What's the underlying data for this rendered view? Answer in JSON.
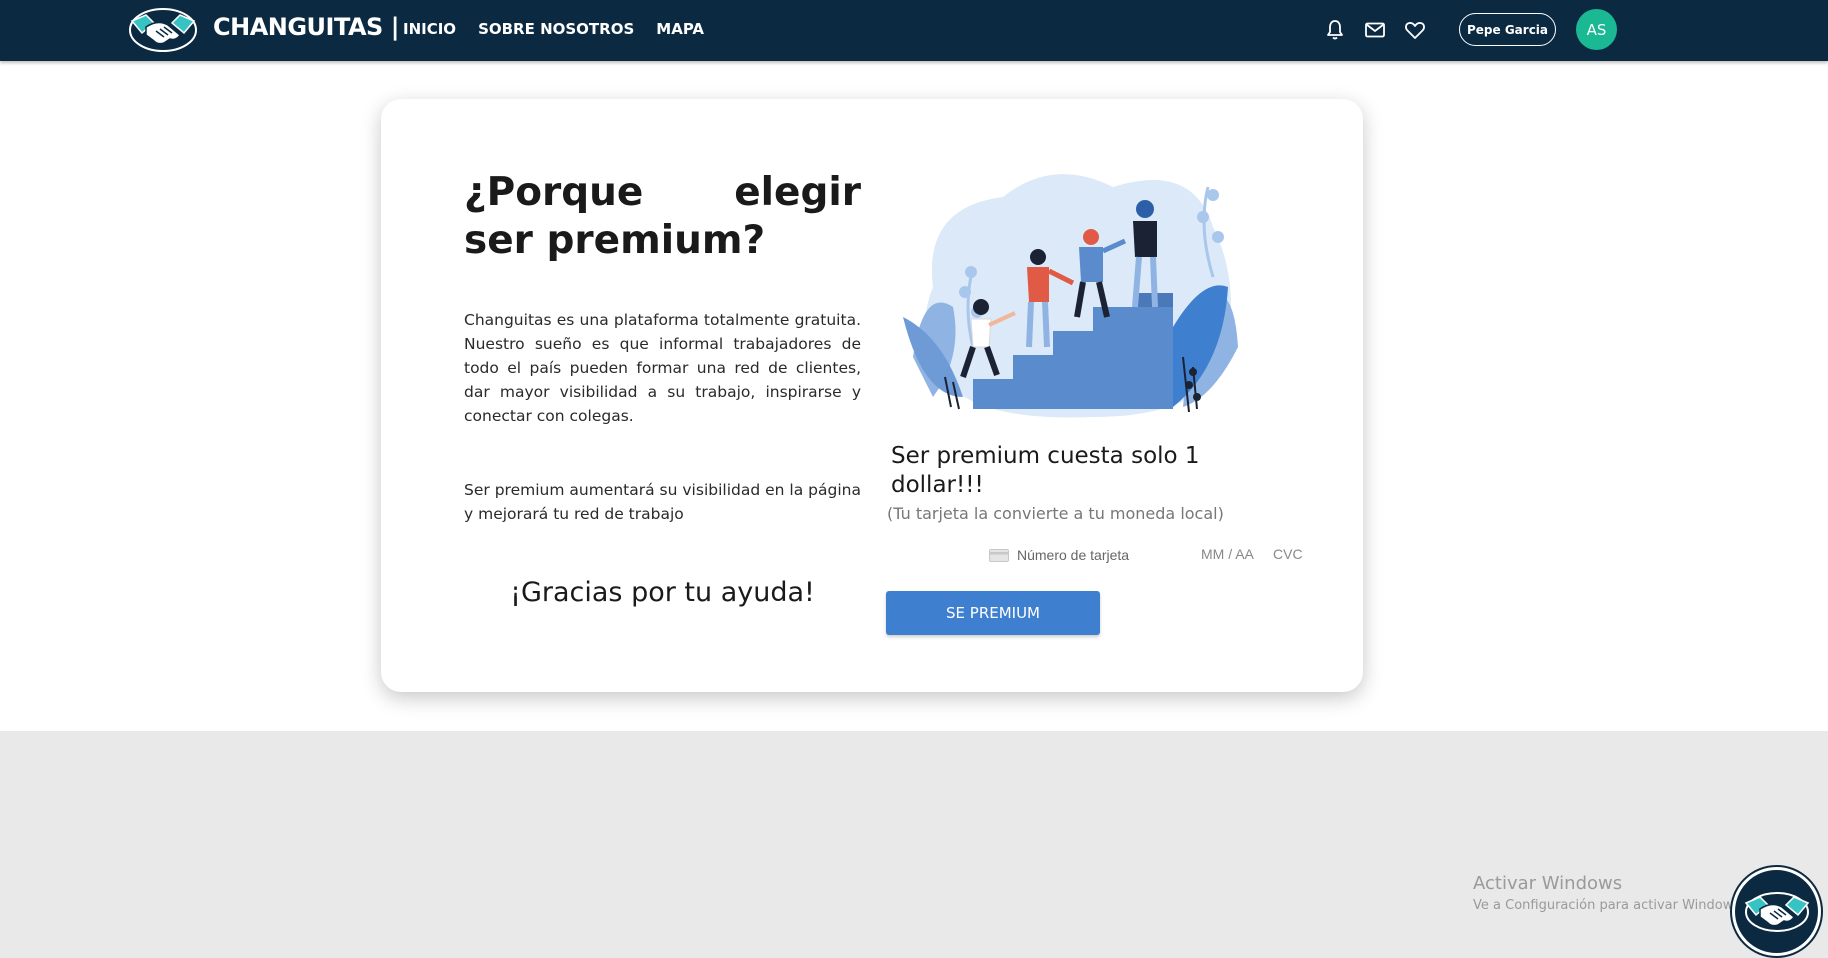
{
  "navbar": {
    "brand": "CHANGUITAS |",
    "links": [
      "INICIO",
      "SOBRE NOSOTROS",
      "MAPA"
    ],
    "icons": [
      "bell-icon",
      "mail-icon",
      "heart-icon"
    ],
    "user_name": "Pepe Garcia",
    "avatar_initials": "AS"
  },
  "card": {
    "title": "¿Porque elegir ser premium?",
    "paragraph1": "Changuitas es una plataforma totalmente gratuita. Nuestro sueño es que informal trabajadores de todo el país pueden formar una red de clientes, dar mayor visibilidad a su trabajo, inspirarse y conectar con colegas.",
    "paragraph2": "Ser premium aumentará su visibilidad en la página y mejorará tu red de trabajo",
    "thanks": "¡Gracias por tu ayuda!",
    "price": "Ser premium cuesta solo 1 dollar!!!",
    "price_note": "(Tu tarjeta la convierte a tu moneda local)",
    "card_number_placeholder": "Número de tarjeta",
    "expiry_placeholder": "MM / AA",
    "cvc_placeholder": "CVC",
    "button_label": "SE PREMIUM"
  },
  "windows_notice": {
    "title": "Activar Windows",
    "subtitle": "Ve a Configuración para activar Windows."
  },
  "colors": {
    "navbar": "#0b2a42",
    "accent_blue": "#3f7fcf",
    "avatar_green": "#1bb894",
    "footer_gray": "#e9e9e9"
  }
}
